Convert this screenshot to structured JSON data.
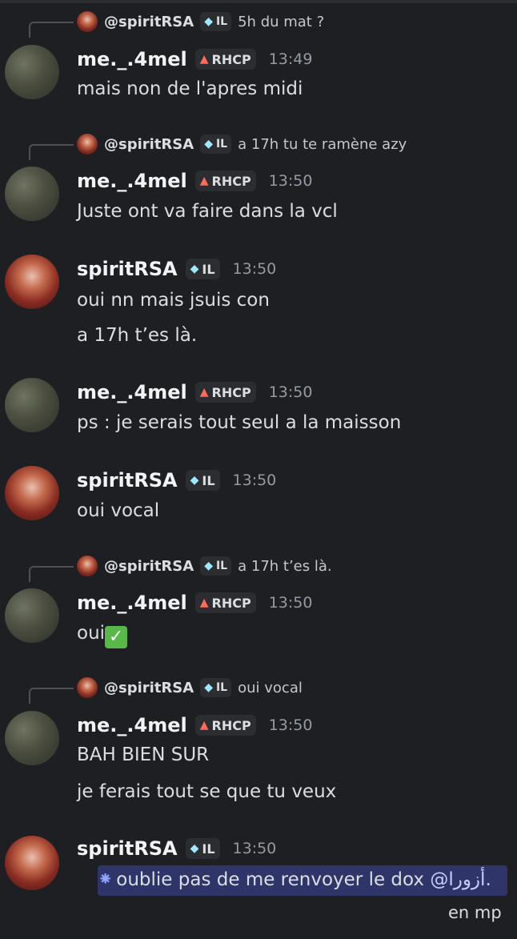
{
  "users": {
    "mel": {
      "name": "me._.4mel",
      "tag": "RHCP"
    },
    "spirit": {
      "name": "spiritRSA",
      "tag": "IL",
      "mention": "@spiritRSA"
    }
  },
  "messages": [
    {
      "reply": {
        "text": "5h du mat ?"
      },
      "time": "13:49",
      "lines": [
        "mais non de l'apres midi"
      ]
    },
    {
      "reply": {
        "text": "a 17h tu te ramène azy"
      },
      "time": "13:50",
      "lines": [
        "Juste ont va faire dans la vcl"
      ]
    },
    {
      "time": "13:50",
      "lines": [
        "oui nn mais jsuis con",
        "a 17h t’es là."
      ]
    },
    {
      "time": "13:50",
      "lines": [
        "ps : je serais tout seul a la maisson"
      ]
    },
    {
      "time": "13:50",
      "lines": [
        "oui vocal"
      ]
    },
    {
      "reply": {
        "text": "a 17h t’es là."
      },
      "time": "13:50",
      "lines": [
        "oui"
      ]
    },
    {
      "reply": {
        "text": "oui vocal"
      },
      "time": "13:50",
      "lines": [
        "BAH BIEN SUR",
        "je ferais tout se que tu veux"
      ]
    },
    {
      "time": "13:50",
      "lines": [
        "oublie pas de me renvoyer le dox",
        "@أزورا.",
        "en mp"
      ]
    }
  ],
  "colors": {
    "background": "#1e1f22",
    "mention_highlight": "#2f3569",
    "tag_bg": "#2b2d31",
    "checkmark": "#58b948"
  },
  "icons": {
    "mel_tag": "flame-icon",
    "spirit_tag": "gem-icon",
    "highlight": "asterisk-icon",
    "check": "check-emoji-icon"
  }
}
